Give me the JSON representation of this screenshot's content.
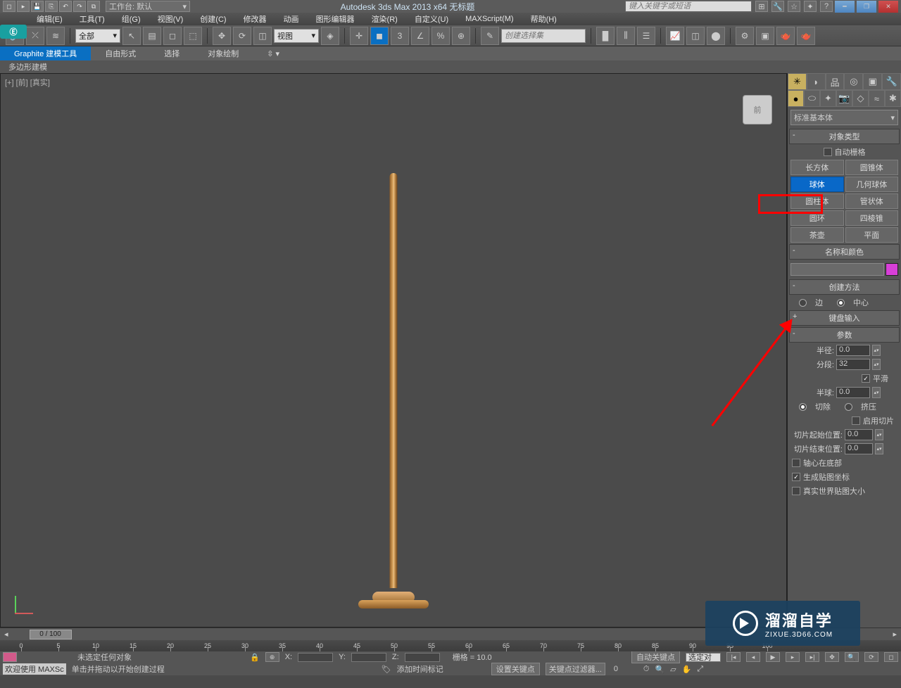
{
  "window": {
    "title": "Autodesk 3ds Max  2013 x64     无标题"
  },
  "qat": {
    "workspace_label": "工作台: 默认",
    "search_placeholder": "键入关键字或短语"
  },
  "menus": [
    "编辑(E)",
    "工具(T)",
    "组(G)",
    "视图(V)",
    "创建(C)",
    "修改器",
    "动画",
    "图形编辑器",
    "渲染(R)",
    "自定义(U)",
    "MAXScript(M)",
    "帮助(H)"
  ],
  "toolbar": {
    "filter_all": "全部",
    "view_dropdown": "视图",
    "selset_placeholder": "创建选择集"
  },
  "ribbon": {
    "tabs": [
      "Graphite 建模工具",
      "自由形式",
      "选择",
      "对象绘制"
    ],
    "sub": "多边形建模"
  },
  "viewport": {
    "label": "[+] [前] [真实]",
    "viewcube": "前"
  },
  "cmdpanel": {
    "category": "标准基本体",
    "roll_objtype": "对象类型",
    "autogrid": "自动栅格",
    "primitives": [
      [
        "长方体",
        "圆锥体"
      ],
      [
        "球体",
        "几何球体"
      ],
      [
        "圆柱体",
        "管状体"
      ],
      [
        "圆环",
        "四棱锥"
      ],
      [
        "茶壶",
        "平面"
      ]
    ],
    "selected_primitive": "球体",
    "roll_name": "名称和颜色",
    "roll_method": "创建方法",
    "method_edge": "边",
    "method_center": "中心",
    "roll_keyboard": "键盘输入",
    "roll_params": "参数",
    "radius_lbl": "半径:",
    "radius_val": "0.0",
    "segs_lbl": "分段:",
    "segs_val": "32",
    "smooth": "平滑",
    "hemi_lbl": "半球:",
    "hemi_val": "0.0",
    "chop": "切除",
    "squash": "挤压",
    "slice_on": "启用切片",
    "slice_from_lbl": "切片起始位置:",
    "slice_from_val": "0.0",
    "slice_to_lbl": "切片结束位置:",
    "slice_to_val": "0.0",
    "pivot_base": "轴心在底部",
    "gen_uv": "生成贴图坐标",
    "realworld": "真实世界贴图大小"
  },
  "timeline": {
    "slider": "0 / 100",
    "ticks": [
      0,
      5,
      10,
      15,
      20,
      25,
      30,
      35,
      40,
      45,
      50,
      55,
      60,
      65,
      70,
      75,
      80,
      85,
      90,
      95,
      100
    ]
  },
  "status": {
    "sel": "未选定任何对象",
    "x_lbl": "X:",
    "y_lbl": "Y:",
    "z_lbl": "Z:",
    "grid": "栅格 = 10.0",
    "autokey": "自动关键点",
    "selkey": "选定对",
    "welcome": "欢迎使用  MAXSc",
    "hint": "单击并拖动以开始创建过程",
    "addtime": "添加时间标记",
    "setkey": "设置关键点",
    "keyfilter": "关键点过滤器..."
  },
  "watermark": {
    "big": "溜溜自学",
    "small": "ZIXUE.3D66.COM"
  }
}
